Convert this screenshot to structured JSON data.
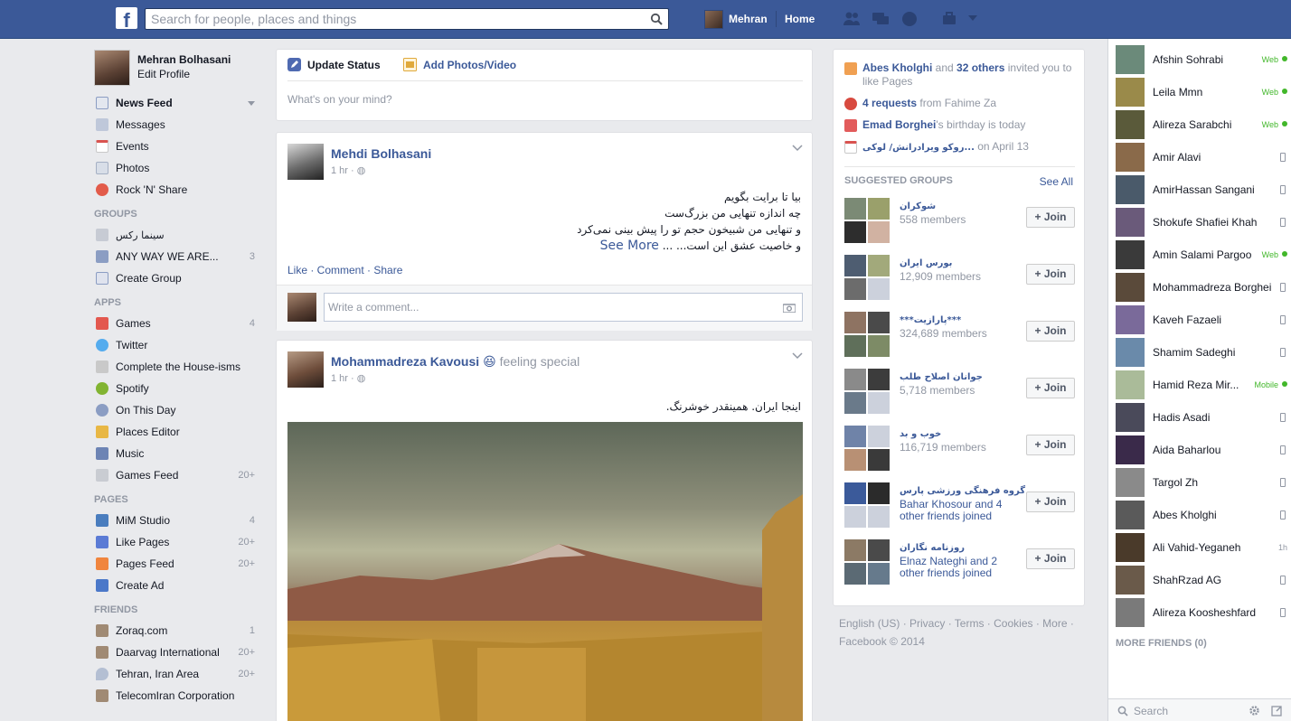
{
  "topbar": {
    "logo": "f",
    "search_placeholder": "Search for people, places and things",
    "user_name": "Mehran",
    "home_label": "Home"
  },
  "profile": {
    "name": "Mehran Bolhasani",
    "edit": "Edit Profile"
  },
  "nav": {
    "favorites": [
      {
        "label": "News Feed",
        "count": ""
      },
      {
        "label": "Messages",
        "count": ""
      },
      {
        "label": "Events",
        "count": ""
      },
      {
        "label": "Photos",
        "count": ""
      },
      {
        "label": "Rock 'N' Share",
        "count": ""
      }
    ],
    "groups_header": "GROUPS",
    "groups": [
      {
        "label": "سینما رکس",
        "count": ""
      },
      {
        "label": "ANY WAY WE ARE...",
        "count": "3"
      },
      {
        "label": "Create Group",
        "count": ""
      }
    ],
    "apps_header": "APPS",
    "apps": [
      {
        "label": "Games",
        "count": "4"
      },
      {
        "label": "Twitter",
        "count": ""
      },
      {
        "label": "Complete the House-isms",
        "count": ""
      },
      {
        "label": "Spotify",
        "count": ""
      },
      {
        "label": "On This Day",
        "count": ""
      },
      {
        "label": "Places Editor",
        "count": ""
      },
      {
        "label": "Music",
        "count": ""
      },
      {
        "label": "Games Feed",
        "count": "20+"
      }
    ],
    "pages_header": "PAGES",
    "pages": [
      {
        "label": "MiM Studio",
        "count": "4"
      },
      {
        "label": "Like Pages",
        "count": "20+"
      },
      {
        "label": "Pages Feed",
        "count": "20+"
      },
      {
        "label": "Create Ad",
        "count": ""
      }
    ],
    "friends_header": "FRIENDS",
    "friends": [
      {
        "label": "Zoraq.com",
        "count": "1"
      },
      {
        "label": "Daarvag International",
        "count": "20+"
      },
      {
        "label": "Tehran, Iran Area",
        "count": "20+"
      },
      {
        "label": "TelecomIran Corporation",
        "count": ""
      }
    ]
  },
  "composer": {
    "update_status": "Update Status",
    "add_photo": "Add Photos/Video",
    "placeholder": "What's on your mind?"
  },
  "post1": {
    "author": "Mehdi Bolhasani",
    "time": "1 hr ·",
    "lines": [
      "بیا تا برایت بگویم",
      "چه اندازه تنهایی من بزرگ‌ست",
      "و تنهایی من شبیخون حجم تو را پیش بینی نمی‌کرد",
      "و خاصیت عشق این است... ..."
    ],
    "see_more": "See More",
    "actions": "Like · Comment · Share",
    "comment_placeholder": "Write a comment..."
  },
  "post2": {
    "author": "Mohammadreza Kavousi",
    "emoji": "😆",
    "feeling": "feeling special",
    "time": "1 hr ·",
    "text": "اینجا ایران. همینقدر خوشرنگ."
  },
  "notices": [
    {
      "bold": "Abes Kholghi",
      "rest1": " and ",
      "bold2": "32 others",
      "rest2": " invited you to like Pages"
    },
    {
      "bold": "4 requests",
      "rest1": " from Fahime Za",
      "bold2": "",
      "rest2": ""
    },
    {
      "bold": "Emad Borghei",
      "rest1": "'s birthday is today",
      "bold2": "",
      "rest2": ""
    },
    {
      "bold": "روکو ویرادرانش/ لوکی...",
      "rest1": " on April 13",
      "bold2": "",
      "rest2": ""
    }
  ],
  "suggested": {
    "header": "SUGGESTED GROUPS",
    "see_all": "See All",
    "join_label": "+ Join",
    "groups": [
      {
        "name": "شوکران",
        "line1": "558 members",
        "line2": ""
      },
      {
        "name": "بورس ایران",
        "line1": "12,909 members",
        "line2": ""
      },
      {
        "name": "***پارازیت***",
        "line1": "324,689 members",
        "line2": ""
      },
      {
        "name": "جوانان اصلاح طلب",
        "line1": "5,718 members",
        "line2": ""
      },
      {
        "name": "خوب و بد",
        "line1": "116,719 members",
        "line2": ""
      },
      {
        "name": "گروه فرهنگی ورزشی پارس",
        "line1": "Bahar Khosour and 4",
        "line2": "other friends joined"
      },
      {
        "name": "روزنامه نگاران",
        "line1": "Elnaz Nateghi and 2",
        "line2": "other friends joined"
      }
    ]
  },
  "footer": {
    "line1": "English (US) · Privacy · Terms · Cookies · More ·",
    "line2": "Facebook © 2014"
  },
  "chat": {
    "friends": [
      {
        "name": "Afshin Sohrabi",
        "status": "Web",
        "dot": true
      },
      {
        "name": "Leila Mmn",
        "status": "Web",
        "dot": true
      },
      {
        "name": "Alireza Sarabchi",
        "status": "Web",
        "dot": true
      },
      {
        "name": "Amir Alavi",
        "status": "",
        "dot": false
      },
      {
        "name": "AmirHassan Sangani",
        "status": "",
        "dot": false
      },
      {
        "name": "Shokufe Shafiei Khah",
        "status": "",
        "dot": false
      },
      {
        "name": "Amin Salami Pargoo",
        "status": "Web",
        "dot": true
      },
      {
        "name": "Mohammadreza Borghei",
        "status": "",
        "dot": false
      },
      {
        "name": "Kaveh Fazaeli",
        "status": "",
        "dot": false
      },
      {
        "name": "Shamim Sadeghi",
        "status": "",
        "dot": false
      },
      {
        "name": "Hamid Reza Mir...",
        "status": "Mobile",
        "dot": true
      },
      {
        "name": "Hadis Asadi",
        "status": "",
        "dot": false
      },
      {
        "name": "Aida Baharlou",
        "status": "",
        "dot": false
      },
      {
        "name": "Targol Zh",
        "status": "",
        "dot": false
      },
      {
        "name": "Abes Kholghi",
        "status": "",
        "dot": false
      },
      {
        "name": "Ali Vahid-Yeganeh",
        "status": "1h",
        "dot": false
      },
      {
        "name": "ShahRzad AG",
        "status": "",
        "dot": false
      },
      {
        "name": "Alireza Koosheshfard",
        "status": "",
        "dot": false
      }
    ],
    "more_friends": "MORE FRIENDS (0)",
    "search": "Search"
  }
}
